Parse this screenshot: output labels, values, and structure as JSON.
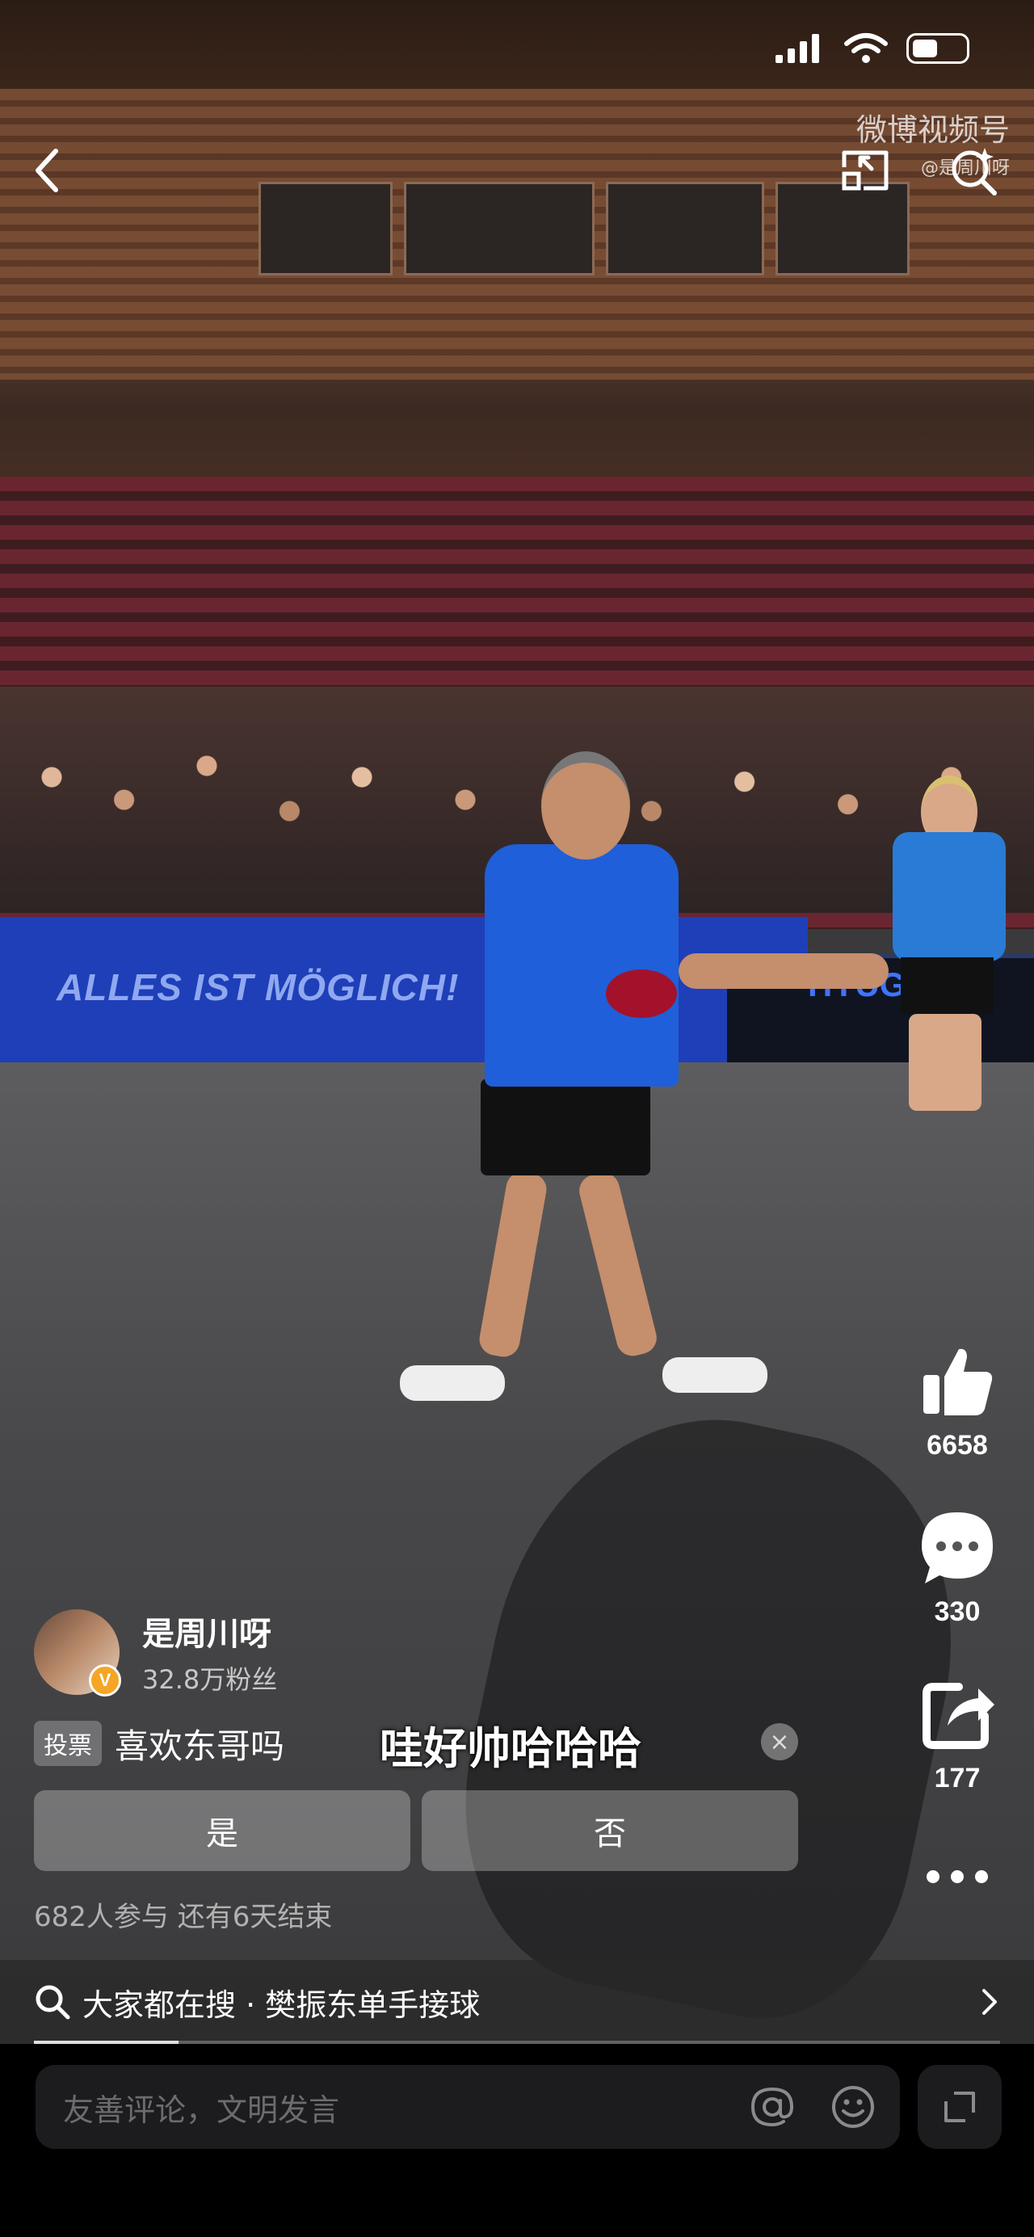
{
  "watermark": {
    "brand": "微博视频号",
    "handle": "@是周川呀"
  },
  "video": {
    "board_text": "ALLES IST MÖGLICH!",
    "table_logo": "HYUG"
  },
  "sidebar": {
    "like_count": "6658",
    "comment_count": "330",
    "share_count": "177"
  },
  "author": {
    "name": "是周川呀",
    "fans": "32.8万粉丝",
    "verified_badge": "V"
  },
  "vote": {
    "tag": "投票",
    "question": "喜欢东哥吗",
    "options": [
      "是",
      "否"
    ],
    "stats": "682人参与  还有6天结束",
    "close_symbol": "×"
  },
  "caption": "哇好帅哈哈哈",
  "search": {
    "label": "大家都在搜 · 樊振东单手接球"
  },
  "progress": {
    "fraction": 0.15
  },
  "comment": {
    "placeholder": "友善评论，文明发言"
  },
  "colors": {
    "board_blue": "#1e3fb8",
    "jersey_blue": "#1f5fd9",
    "badge_orange": "#f6a524"
  }
}
